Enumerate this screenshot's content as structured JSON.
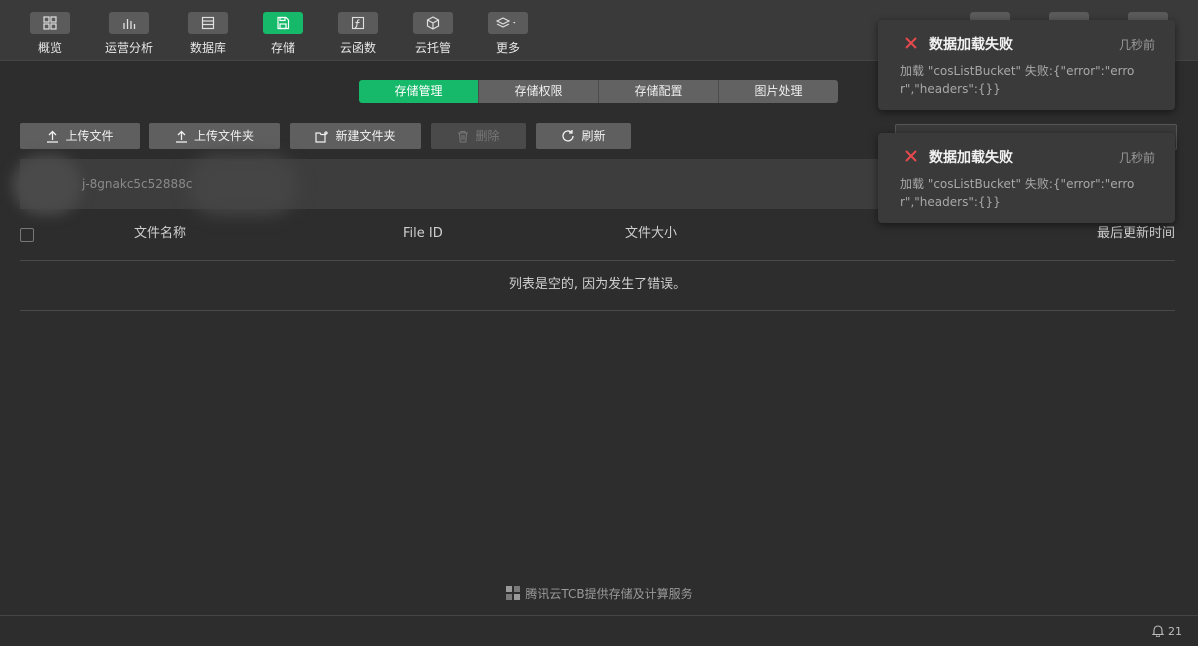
{
  "toolbar": {
    "items": [
      {
        "label": "概览",
        "icon": "grid-icon"
      },
      {
        "label": "运营分析",
        "icon": "bar-chart-icon"
      },
      {
        "label": "数据库",
        "icon": "database-icon"
      },
      {
        "label": "存储",
        "icon": "save-icon"
      },
      {
        "label": "云函数",
        "icon": "function-icon"
      },
      {
        "label": "云托管",
        "icon": "cube-icon"
      },
      {
        "label": "更多",
        "icon": "layers-icon"
      }
    ],
    "active": "存储"
  },
  "tabs": [
    "存储管理",
    "存储权限",
    "存储配置",
    "图片处理"
  ],
  "active_tab": "存储管理",
  "actions": {
    "upload_file": "上传文件",
    "upload_folder": "上传文件夹",
    "new_folder": "新建文件夹",
    "delete": "删除",
    "refresh": "刷新"
  },
  "path": {
    "text": "j-8gnakc5c52888c"
  },
  "table": {
    "columns": [
      "文件名称",
      "File ID",
      "文件大小",
      "最后更新时间"
    ],
    "empty_message": "列表是空的, 因为发生了错误。"
  },
  "footer": {
    "brand": "腾讯云TCB提供存储及计算服务",
    "notification_count": "21"
  },
  "toasts": [
    {
      "title": "数据加载失败",
      "time": "几秒前",
      "body": "加载 \"cosListBucket\" 失败:{\"error\":\"error\",\"headers\":{}}"
    },
    {
      "title": "数据加载失败",
      "time": "几秒前",
      "body": "加载 \"cosListBucket\" 失败:{\"error\":\"error\",\"headers\":{}}"
    }
  ],
  "colors": {
    "accent": "#16b96a",
    "error": "#e5484d",
    "background": "#2d2d2d"
  }
}
